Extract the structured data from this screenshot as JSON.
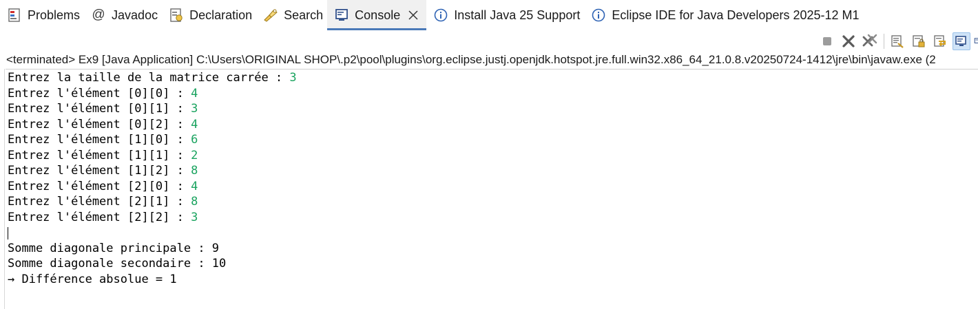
{
  "tabs": [
    {
      "label": "Problems",
      "icon": "problems-icon"
    },
    {
      "label": "Javadoc",
      "icon": "javadoc-icon"
    },
    {
      "label": "Declaration",
      "icon": "declaration-icon"
    },
    {
      "label": "Search",
      "icon": "search-icon"
    },
    {
      "label": "Console",
      "icon": "console-icon",
      "active": true
    },
    {
      "label": "Install Java 25 Support",
      "icon": "info-icon"
    },
    {
      "label": "Eclipse IDE for Java Developers 2025-12 M1",
      "icon": "info-icon"
    }
  ],
  "toolbar": {
    "icons": [
      "terminate-icon",
      "remove-launch-icon",
      "remove-all-terminated-icon",
      "clear-console-icon",
      "scroll-lock-icon",
      "word-wrap-icon",
      "pin-console-icon",
      "display-selected-console-icon"
    ]
  },
  "process": {
    "text": "<terminated> Ex9 [Java Application] C:\\Users\\ORIGINAL SHOP\\.p2\\pool\\plugins\\org.eclipse.justj.openjdk.hotspot.jre.full.win32.x86_64_21.0.8.v20250724-1412\\jre\\bin\\javaw.exe  (2"
  },
  "console": {
    "lines": [
      {
        "prompt": "Entrez la taille de la matrice carrée : ",
        "input": "3"
      },
      {
        "prompt": "Entrez l'élément [0][0] : ",
        "input": "4"
      },
      {
        "prompt": "Entrez l'élément [0][1] : ",
        "input": "3"
      },
      {
        "prompt": "Entrez l'élément [0][2] : ",
        "input": "4"
      },
      {
        "prompt": "Entrez l'élément [1][0] : ",
        "input": "6"
      },
      {
        "prompt": "Entrez l'élément [1][1] : ",
        "input": "2"
      },
      {
        "prompt": "Entrez l'élément [1][2] : ",
        "input": "8"
      },
      {
        "prompt": "Entrez l'élément [2][0] : ",
        "input": "4"
      },
      {
        "prompt": "Entrez l'élément [2][1] : ",
        "input": "8"
      },
      {
        "prompt": "Entrez l'élément [2][2] : ",
        "input": "3"
      },
      {
        "prompt": "",
        "input": ""
      },
      {
        "prompt": "Somme diagonale principale : 9",
        "input": ""
      },
      {
        "prompt": "Somme diagonale secondaire : 10",
        "input": ""
      },
      {
        "prompt": "→ Différence absolue = 1",
        "input": ""
      }
    ],
    "input_color": "#1aa35f"
  },
  "colors": {
    "active_tab_underline": "#4a79b8",
    "info_blue": "#2f63b4"
  }
}
